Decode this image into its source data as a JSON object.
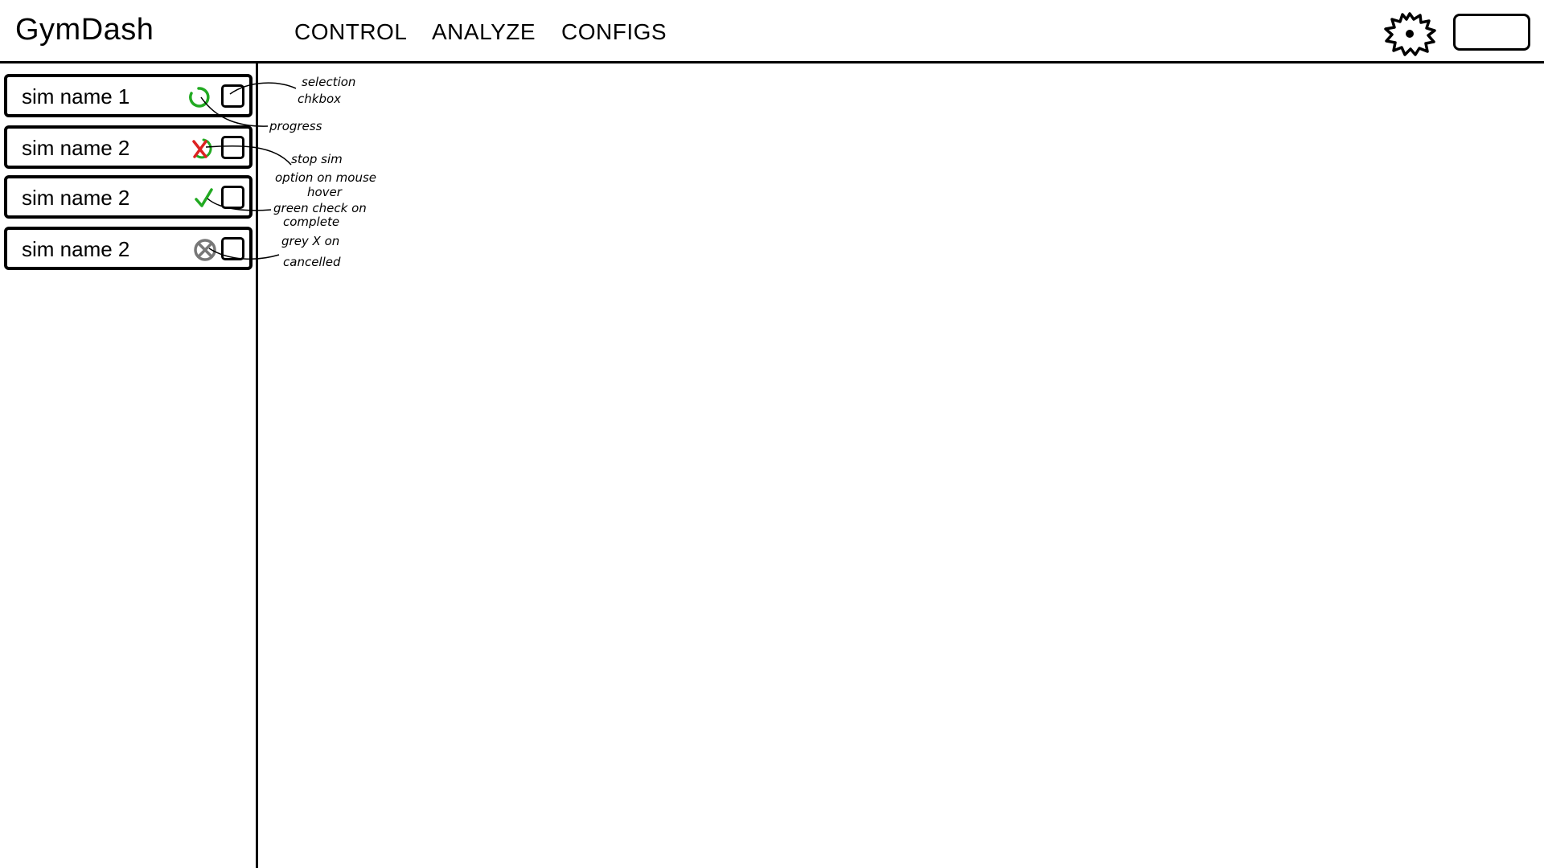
{
  "app": {
    "title": "GymDash"
  },
  "nav": {
    "tabs": [
      {
        "label": "CONTROL"
      },
      {
        "label": "ANALYZE"
      },
      {
        "label": "CONFIGS"
      }
    ]
  },
  "header": {
    "gear_icon": "gear-icon"
  },
  "sidebar": {
    "items": [
      {
        "name": "sim name 1",
        "status": "in-progress",
        "status_icon": "progress-spinner-icon",
        "status_color": "#22aa22",
        "checked": false
      },
      {
        "name": "sim name 2",
        "status": "stop-on-hover",
        "status_icon": "stop-x-icon",
        "status_color": "#dd2222",
        "checked": false
      },
      {
        "name": "sim name 2",
        "status": "complete",
        "status_icon": "check-icon",
        "status_color": "#22aa22",
        "checked": false
      },
      {
        "name": "sim name 2",
        "status": "cancelled",
        "status_icon": "cancelled-x-icon",
        "status_color": "#777777",
        "checked": false
      }
    ]
  },
  "annotations": {
    "selection": [
      "selection",
      "chkbox"
    ],
    "progress": [
      "progress"
    ],
    "stop": [
      "stop sim",
      "option on mouse",
      "hover"
    ],
    "complete": [
      "green check on",
      "complete"
    ],
    "cancelled": [
      "grey X on",
      "cancelled"
    ]
  }
}
